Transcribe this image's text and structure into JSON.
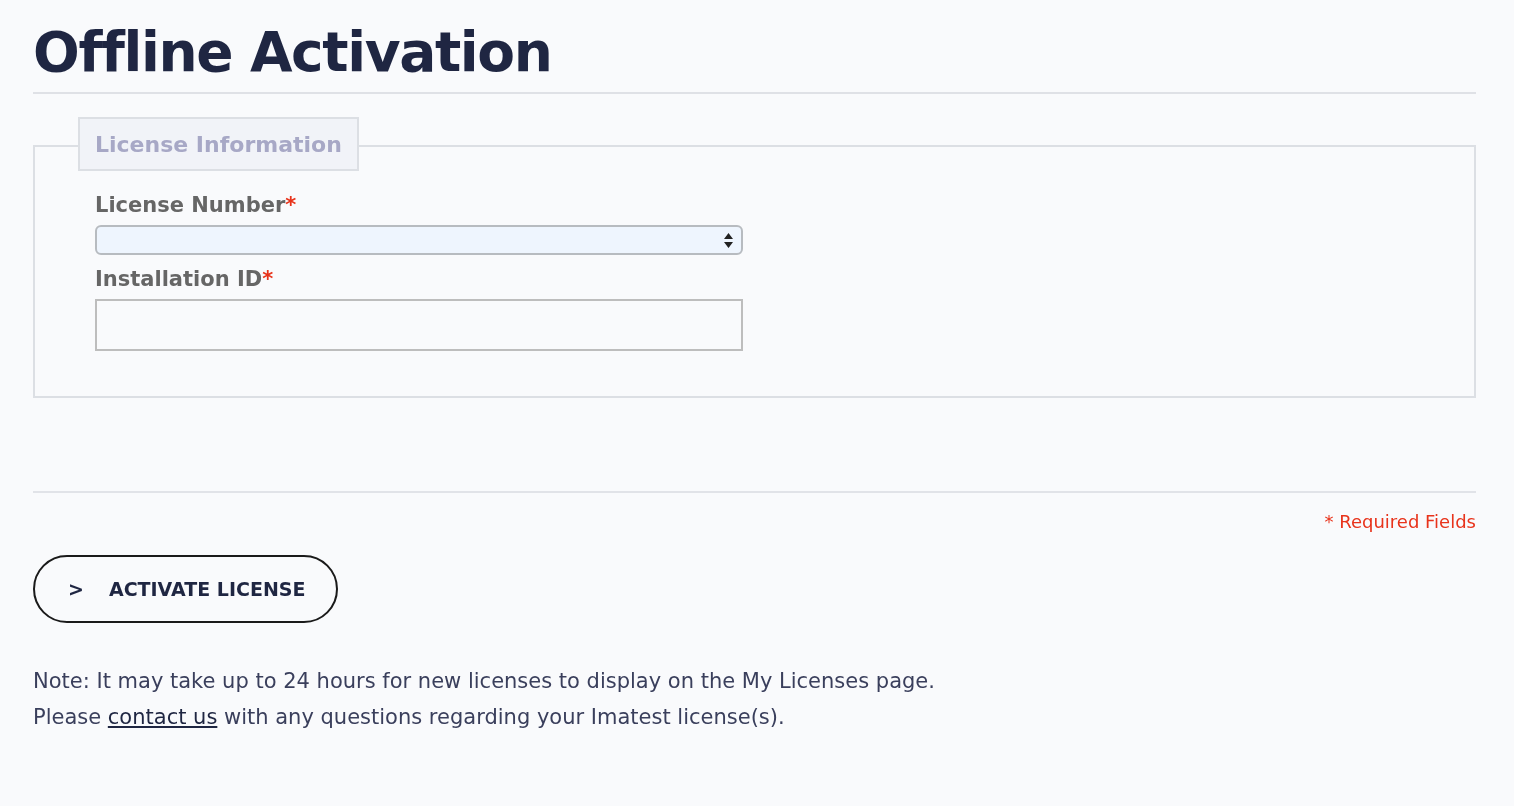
{
  "title": "Offline Activation",
  "fieldset": {
    "legend": "License Information",
    "fields": [
      {
        "kind": "select",
        "label": "License Number",
        "required_mark": "*"
      },
      {
        "kind": "text",
        "label": "Installation ID",
        "required_mark": "*"
      }
    ]
  },
  "required_note": "* Required Fields",
  "button": {
    "icon": ">",
    "label": "ACTIVATE LICENSE"
  },
  "note": {
    "line_1": "Note: It may take up to 24 hours for new licenses to display on the My Licenses page.",
    "line_2_before": "Please ",
    "line_2_link": "contact us",
    "line_2_after": " with any questions regarding your Imatest license(s)."
  }
}
